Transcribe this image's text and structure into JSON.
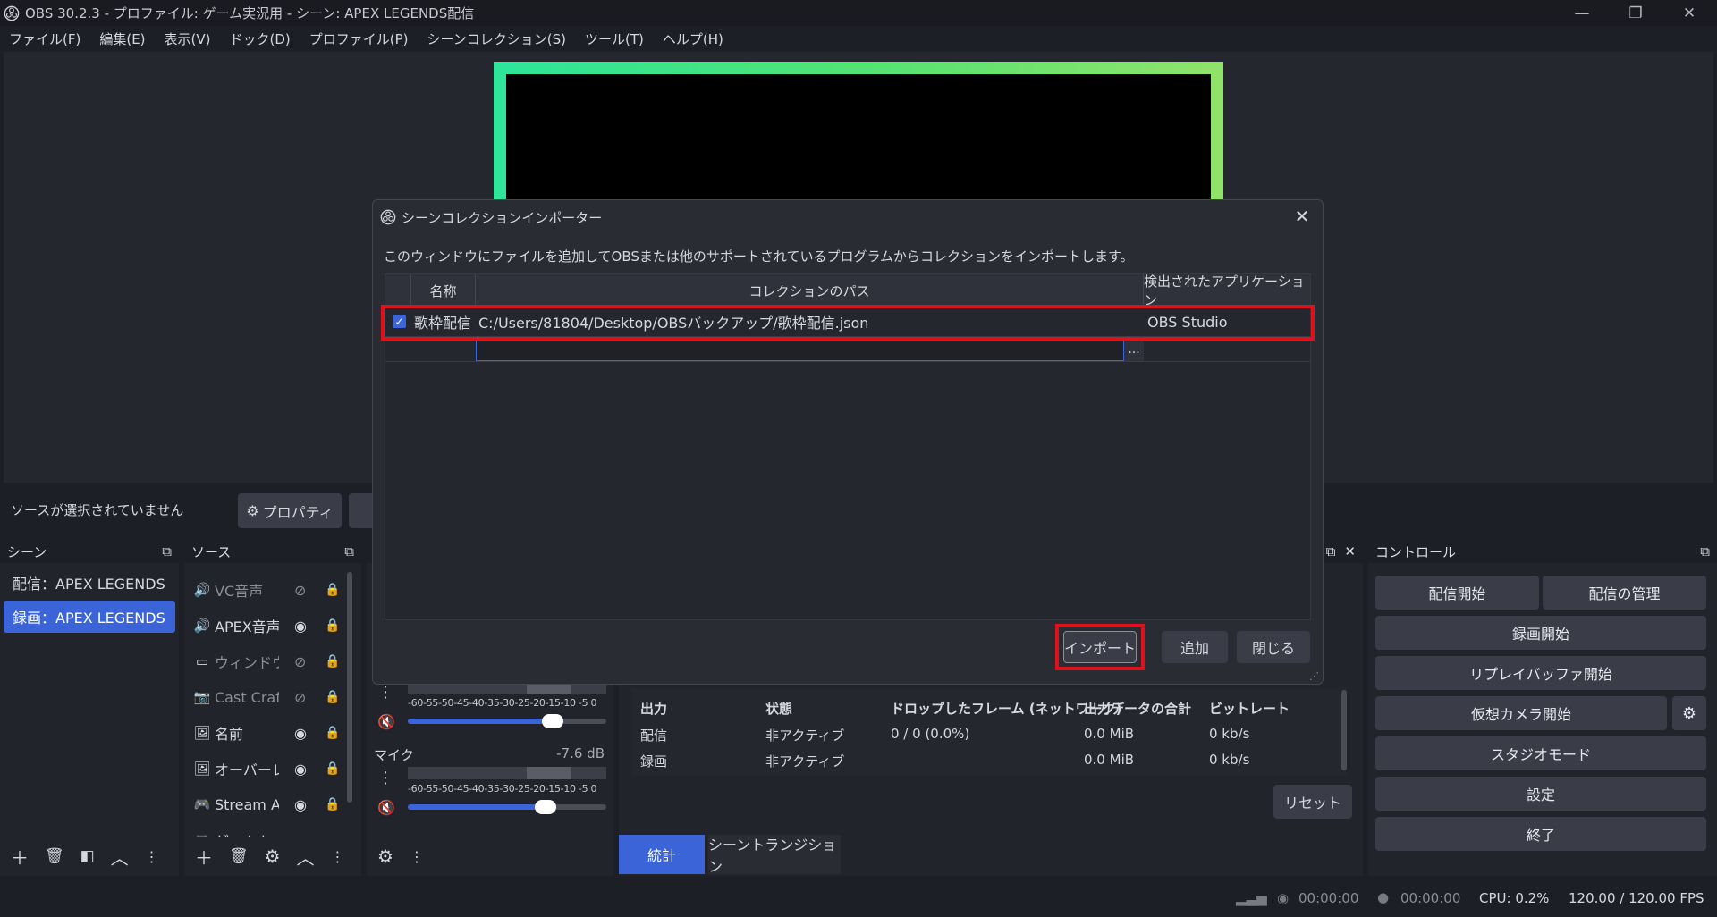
{
  "window": {
    "title": "OBS 30.2.3 - プロファイル: ゲーム実況用 - シーン: APEX LEGENDS配信",
    "minimize": "—",
    "restore": "❐",
    "close": "✕"
  },
  "menu": [
    "ファイル(F)",
    "編集(E)",
    "表示(V)",
    "ドック(D)",
    "プロファイル(P)",
    "シーンコレクション(S)",
    "ツール(T)",
    "ヘルプ(H)"
  ],
  "source_bar": {
    "no_source": "ソースが選択されていません",
    "properties": "プロパティ"
  },
  "scenes": {
    "header": "シーン",
    "items": [
      "配信：APEX LEGENDS",
      "録画：APEX LEGENDS"
    ],
    "selected_index": 1
  },
  "sources": {
    "header": "ソース",
    "items": [
      {
        "label": "VC音声",
        "icon": "speaker-icon",
        "visible": false
      },
      {
        "label": "APEX音声",
        "icon": "speaker-icon",
        "visible": true
      },
      {
        "label": "ウィンドウキャプチャ",
        "icon": "window-icon",
        "visible": false
      },
      {
        "label": "Cast Craft",
        "icon": "camera-icon",
        "visible": false
      },
      {
        "label": "名前",
        "icon": "image-icon",
        "visible": true
      },
      {
        "label": "オーバーレイ",
        "icon": "image-icon",
        "visible": true
      },
      {
        "label": "Stream Av",
        "icon": "gamepad-icon",
        "visible": true
      },
      {
        "label": "ゲームキャプチャ",
        "icon": "gamepad-icon",
        "visible": true
      }
    ]
  },
  "mixer": {
    "scale": "-60-55-50-45-40-35-30-25-20-15-10 -5  0",
    "channels": [
      {
        "name": "",
        "db": "",
        "muted": true,
        "volume": 0.72
      },
      {
        "name": "マイク",
        "db": "-7.6 dB",
        "muted": true,
        "volume": 0.69
      }
    ]
  },
  "stats": {
    "headers": [
      "出力",
      "状態",
      "ドロップしたフレーム (ネットワーク)",
      "出力データの合計",
      "ビットレート"
    ],
    "rows": [
      [
        "配信",
        "非アクティブ",
        "0 / 0 (0.0%)",
        "0.0 MiB",
        "0 kb/s"
      ],
      [
        "録画",
        "非アクティブ",
        "",
        "0.0 MiB",
        "0 kb/s"
      ]
    ],
    "reset": "リセット",
    "tabs": [
      "統計",
      "シーントランジション"
    ]
  },
  "controls": {
    "header": "コントロール",
    "buttons": {
      "start_stream": "配信開始",
      "manage_stream": "配信の管理",
      "start_record": "録画開始",
      "replay_buffer": "リプレイバッファ開始",
      "virtual_cam": "仮想カメラ開始",
      "studio_mode": "スタジオモード",
      "settings": "設定",
      "exit": "終了"
    }
  },
  "statusbar": {
    "stream_time": "00:00:00",
    "rec_time": "00:00:00",
    "cpu": "CPU: 0.2%",
    "fps": "120.00 / 120.00 FPS"
  },
  "dialog": {
    "title": "シーンコレクションインポーター",
    "description": "このウィンドウにファイルを追加してOBSまたは他のサポートされているプログラムからコレクションをインポートします。",
    "columns": [
      "名称",
      "コレクションのパス",
      "検出されたアプリケーション"
    ],
    "rows": [
      {
        "checked": true,
        "name": "歌枠配信",
        "path": "C:/Users/81804/Desktop/OBSバックアップ/歌枠配信.json",
        "app": "OBS Studio"
      }
    ],
    "browse": "...",
    "buttons": {
      "import": "インポート",
      "add": "追加",
      "close": "閉じる"
    }
  },
  "colors": {
    "accent": "#3a64d8",
    "highlight": "#e0111b",
    "frame": "#3de78a"
  }
}
